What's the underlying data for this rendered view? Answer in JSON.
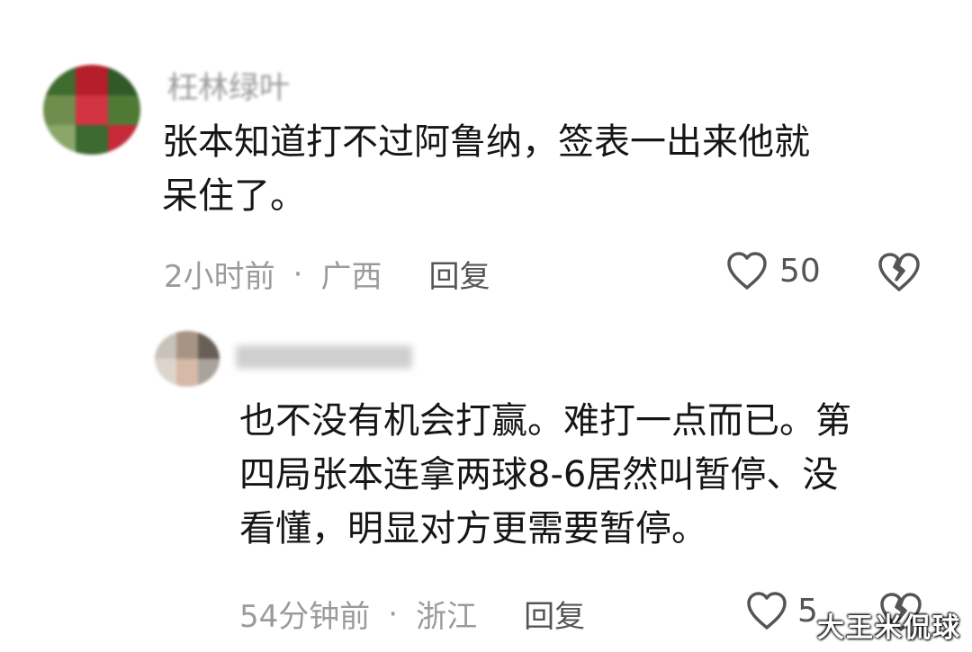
{
  "comments": [
    {
      "nickname": "枉林绿叶",
      "lines": [
        "张本知道打不过阿鲁纳，签表一出来他就",
        "呆住了。"
      ],
      "time": "2小时前",
      "separator": "·",
      "location": "广西",
      "reply_label": "回复",
      "likes": "50"
    },
    {
      "lines": [
        "也不没有机会打赢。难打一点而已。第",
        "四局张本连拿两球8-6居然叫暂停、没",
        "看懂，明显对方更需要暂停。"
      ],
      "time": "54分钟前",
      "separator": "·",
      "location": "浙江",
      "reply_label": "回复",
      "likes": "5"
    }
  ],
  "icons": {
    "like": "heart-outline-icon",
    "dislike": "broken-heart-icon"
  },
  "colors": {
    "text": "#161616",
    "meta": "#9b9b9b",
    "action": "#555555"
  },
  "watermark": "大王米侃球"
}
